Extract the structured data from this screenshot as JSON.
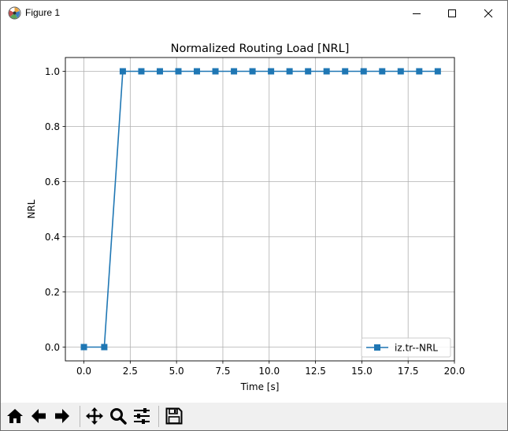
{
  "window": {
    "title": "Figure 1",
    "controls": [
      "minimize-icon",
      "maximize-icon",
      "close-icon"
    ]
  },
  "toolbar": {
    "buttons": [
      {
        "name": "home-button",
        "icon": "home-icon"
      },
      {
        "name": "back-button",
        "icon": "arrow-left-icon"
      },
      {
        "name": "forward-button",
        "icon": "arrow-right-icon"
      },
      {
        "name": "pan-button",
        "icon": "move-icon"
      },
      {
        "name": "zoom-button",
        "icon": "magnifier-icon"
      },
      {
        "name": "configure-subplots-button",
        "icon": "sliders-icon"
      },
      {
        "name": "save-button",
        "icon": "floppy-disk-icon"
      }
    ]
  },
  "chart_data": {
    "type": "line",
    "title": "Normalized Routing Load [NRL]",
    "xlabel": "Time [s]",
    "ylabel": "NRL",
    "xlim": [
      -1,
      20
    ],
    "ylim": [
      -0.05,
      1.05
    ],
    "xticks": [
      "0.0",
      "2.5",
      "5.0",
      "7.5",
      "10.0",
      "12.5",
      "15.0",
      "17.5",
      "20.0"
    ],
    "yticks": [
      "0.0",
      "0.2",
      "0.4",
      "0.6",
      "0.8",
      "1.0"
    ],
    "grid": true,
    "legend_position": "lower right",
    "series": [
      {
        "name": "iz.tr--NRL",
        "color": "#1f77b4",
        "marker": "square",
        "x": [
          0.0,
          1.1,
          2.1,
          3.1,
          4.1,
          5.1,
          6.1,
          7.1,
          8.1,
          9.1,
          10.1,
          11.1,
          12.1,
          13.1,
          14.1,
          15.1,
          16.1,
          17.1,
          18.1,
          19.1
        ],
        "y": [
          0,
          0,
          1,
          1,
          1,
          1,
          1,
          1,
          1,
          1,
          1,
          1,
          1,
          1,
          1,
          1,
          1,
          1,
          1,
          1
        ]
      }
    ]
  }
}
